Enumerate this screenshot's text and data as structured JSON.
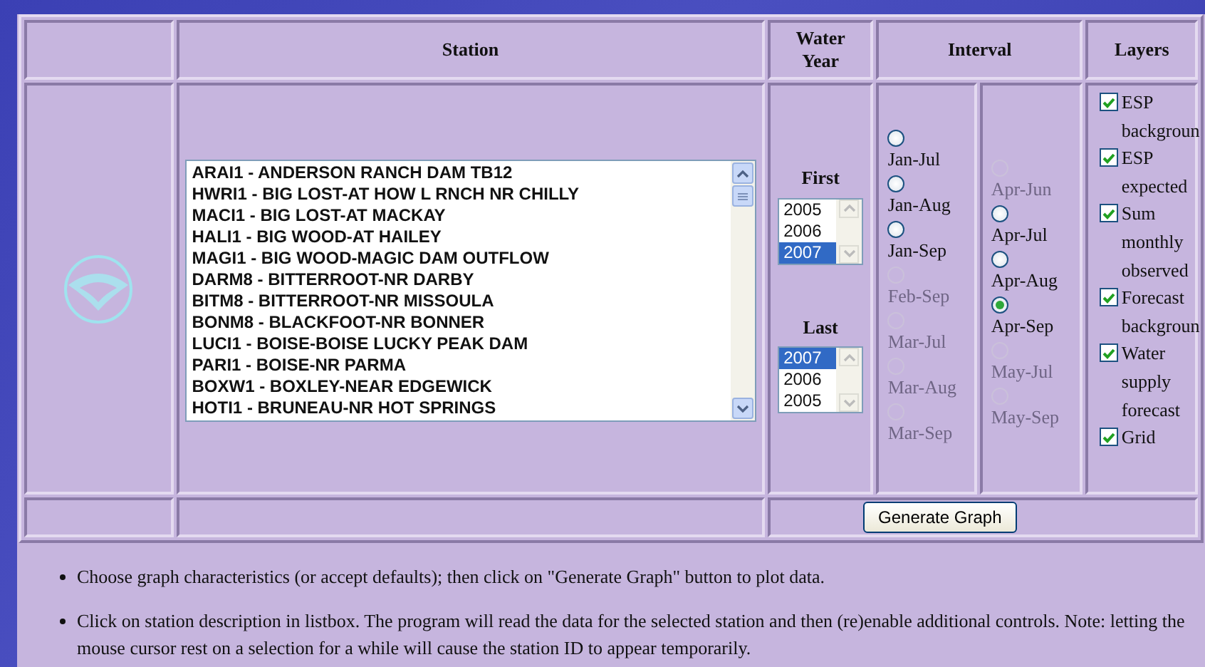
{
  "columns": [
    "Station",
    "Water Year",
    "Interval",
    "Layers"
  ],
  "stations": [
    "ARAI1 - ANDERSON RANCH DAM TB12",
    "HWRI1 - BIG LOST-AT HOW L RNCH NR CHILLY",
    "MACI1 - BIG LOST-AT MACKAY",
    "HALI1 - BIG WOOD-AT HAILEY",
    "MAGI1 - BIG WOOD-MAGIC DAM OUTFLOW",
    "DARM8 - BITTERROOT-NR DARBY",
    "BITM8 - BITTERROOT-NR MISSOULA",
    "BONM8 - BLACKFOOT-NR BONNER",
    "LUCI1 - BOISE-BOISE LUCKY PEAK DAM",
    "PARI1 - BOISE-NR PARMA",
    "BOXW1 - BOXLEY-NEAR EDGEWICK",
    "HOTI1 - BRUNEAU-NR HOT SPRINGS"
  ],
  "water_year": [
    {
      "label": "First",
      "options": [
        {
          "label": "2005",
          "selected": false
        },
        {
          "label": "2006",
          "selected": false
        },
        {
          "label": "2007",
          "selected": true
        }
      ]
    },
    {
      "label": "Last",
      "options": [
        {
          "label": "2007",
          "selected": true
        },
        {
          "label": "2006",
          "selected": false
        },
        {
          "label": "2005",
          "selected": false
        }
      ]
    }
  ],
  "interval": [
    [
      {
        "label": "Jan-Jul",
        "disabled": false,
        "selected": false
      },
      {
        "label": "Jan-Aug",
        "disabled": false,
        "selected": false
      },
      {
        "label": "Jan-Sep",
        "disabled": false,
        "selected": false
      },
      {
        "label": "Feb-Sep",
        "disabled": true,
        "selected": false
      },
      {
        "label": "Mar-Jul",
        "disabled": true,
        "selected": false
      },
      {
        "label": "Mar-Aug",
        "disabled": true,
        "selected": false
      },
      {
        "label": "Mar-Sep",
        "disabled": true,
        "selected": false
      }
    ],
    [
      {
        "label": "Apr-Jun",
        "disabled": true,
        "selected": false
      },
      {
        "label": "Apr-Jul",
        "disabled": false,
        "selected": false
      },
      {
        "label": "Apr-Aug",
        "disabled": false,
        "selected": false
      },
      {
        "label": "Apr-Sep",
        "disabled": false,
        "selected": true
      },
      {
        "label": "May-Jul",
        "disabled": true,
        "selected": false
      },
      {
        "label": "May-Sep",
        "disabled": true,
        "selected": false
      }
    ]
  ],
  "layers": [
    {
      "label": "ESP backgroun",
      "checked": true
    },
    {
      "label": "ESP expected",
      "checked": true
    },
    {
      "label": "Sum monthly observed",
      "checked": true
    },
    {
      "label": "Forecast backgroun",
      "checked": true
    },
    {
      "label": "Water supply forecast",
      "checked": true
    },
    {
      "label": "Grid",
      "checked": true
    }
  ],
  "button": "Generate Graph",
  "instructions": [
    "Choose graph characteristics (or accept defaults); then click on \"Generate Graph\" button to plot data.",
    "Click on station description in listbox. The program will read the data for the selected station and then (re)enable additional controls. Note: letting the mouse cursor rest on a selection for a while will cause the station ID to appear temporarily."
  ]
}
